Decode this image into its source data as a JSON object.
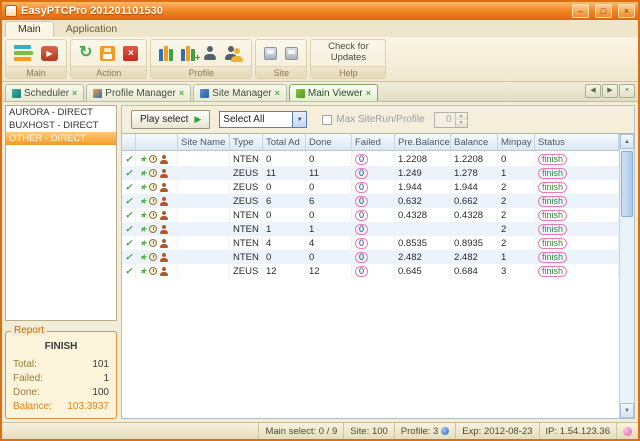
{
  "window": {
    "title": "EasyPTCPro 201201101530"
  },
  "colors": {
    "titlebar_orange": "#ee7a1e",
    "selection_orange": "#f7a02b",
    "pill_outline_pink": "#e87bb5",
    "status_green": "#2f8f3a",
    "failed_blue": "#16368c"
  },
  "ribbon": {
    "tabs": [
      {
        "label": "Main"
      },
      {
        "label": "Application"
      }
    ],
    "groups": [
      {
        "caption": "Main"
      },
      {
        "caption": "Action"
      },
      {
        "caption": "Profile"
      },
      {
        "caption": "Site"
      },
      {
        "caption": "Help",
        "button_label": "Check for Updates"
      }
    ]
  },
  "doc_tabs": [
    {
      "label": "Scheduler"
    },
    {
      "label": "Profile Manager"
    },
    {
      "label": "Site Manager"
    },
    {
      "label": "Main Viewer"
    }
  ],
  "profile_list": {
    "items": [
      {
        "label": "AURORA - DIRECT"
      },
      {
        "label": "BUXHOST - DIRECT"
      },
      {
        "label": "OTHER - DIRECT"
      }
    ],
    "selected_index": 2
  },
  "report": {
    "title": "Report",
    "state": "FINISH",
    "rows": [
      {
        "label": "Total:",
        "value": "101"
      },
      {
        "label": "Failed:",
        "value": "1"
      },
      {
        "label": "Done:",
        "value": "100"
      },
      {
        "label": "Balance:",
        "value": "103.3937"
      }
    ]
  },
  "toolbar": {
    "play_label": "Play select",
    "select_value": "Select All",
    "max_label": "Max SiteRun/Profile",
    "spinner_value": "0"
  },
  "table": {
    "columns": [
      "",
      "",
      "Site Name",
      "Type",
      "Total Ad",
      "Done",
      "Failed",
      "Pre.Balance",
      "Balance",
      "Minpay",
      "Status"
    ],
    "rows": [
      {
        "site_name": "",
        "type": "NTEN",
        "total_ad": "0",
        "done": "0",
        "failed": "0",
        "pre_balance": "1.2208",
        "balance": "1.2208",
        "minpay": "0",
        "status": "finish"
      },
      {
        "site_name": "",
        "type": "ZEUS",
        "total_ad": "11",
        "done": "11",
        "failed": "0",
        "pre_balance": "1.249",
        "balance": "1.278",
        "minpay": "1",
        "status": "finish"
      },
      {
        "site_name": "",
        "type": "ZEUS",
        "total_ad": "0",
        "done": "0",
        "failed": "0",
        "pre_balance": "1.944",
        "balance": "1.944",
        "minpay": "2",
        "status": "finish"
      },
      {
        "site_name": "",
        "type": "ZEUS",
        "total_ad": "6",
        "done": "6",
        "failed": "0",
        "pre_balance": "0.632",
        "balance": "0.662",
        "minpay": "2",
        "status": "finish"
      },
      {
        "site_name": "",
        "type": "NTEN",
        "total_ad": "0",
        "done": "0",
        "failed": "0",
        "pre_balance": "0.4328",
        "balance": "0.4328",
        "minpay": "2",
        "status": "finish"
      },
      {
        "site_name": "",
        "type": "NTEN",
        "total_ad": "1",
        "done": "1",
        "failed": "0",
        "pre_balance": "",
        "balance": "",
        "minpay": "2",
        "status": "finish"
      },
      {
        "site_name": "",
        "type": "NTEN",
        "total_ad": "4",
        "done": "4",
        "failed": "0",
        "pre_balance": "0.8535",
        "balance": "0.8935",
        "minpay": "2",
        "status": "finish"
      },
      {
        "site_name": "",
        "type": "NTEN",
        "total_ad": "0",
        "done": "0",
        "failed": "0",
        "pre_balance": "2.482",
        "balance": "2.482",
        "minpay": "1",
        "status": "finish"
      },
      {
        "site_name": "",
        "type": "ZEUS",
        "total_ad": "12",
        "done": "12",
        "failed": "0",
        "pre_balance": "0.645",
        "balance": "0.684",
        "minpay": "3",
        "status": "finish"
      }
    ]
  },
  "status_bar": {
    "main_select": "Main select: 0 / 9",
    "site": "Site: 100",
    "profile": "Profile: 3",
    "exp": "Exp: 2012-08-23",
    "ip": "IP: 1.54.123.36"
  }
}
